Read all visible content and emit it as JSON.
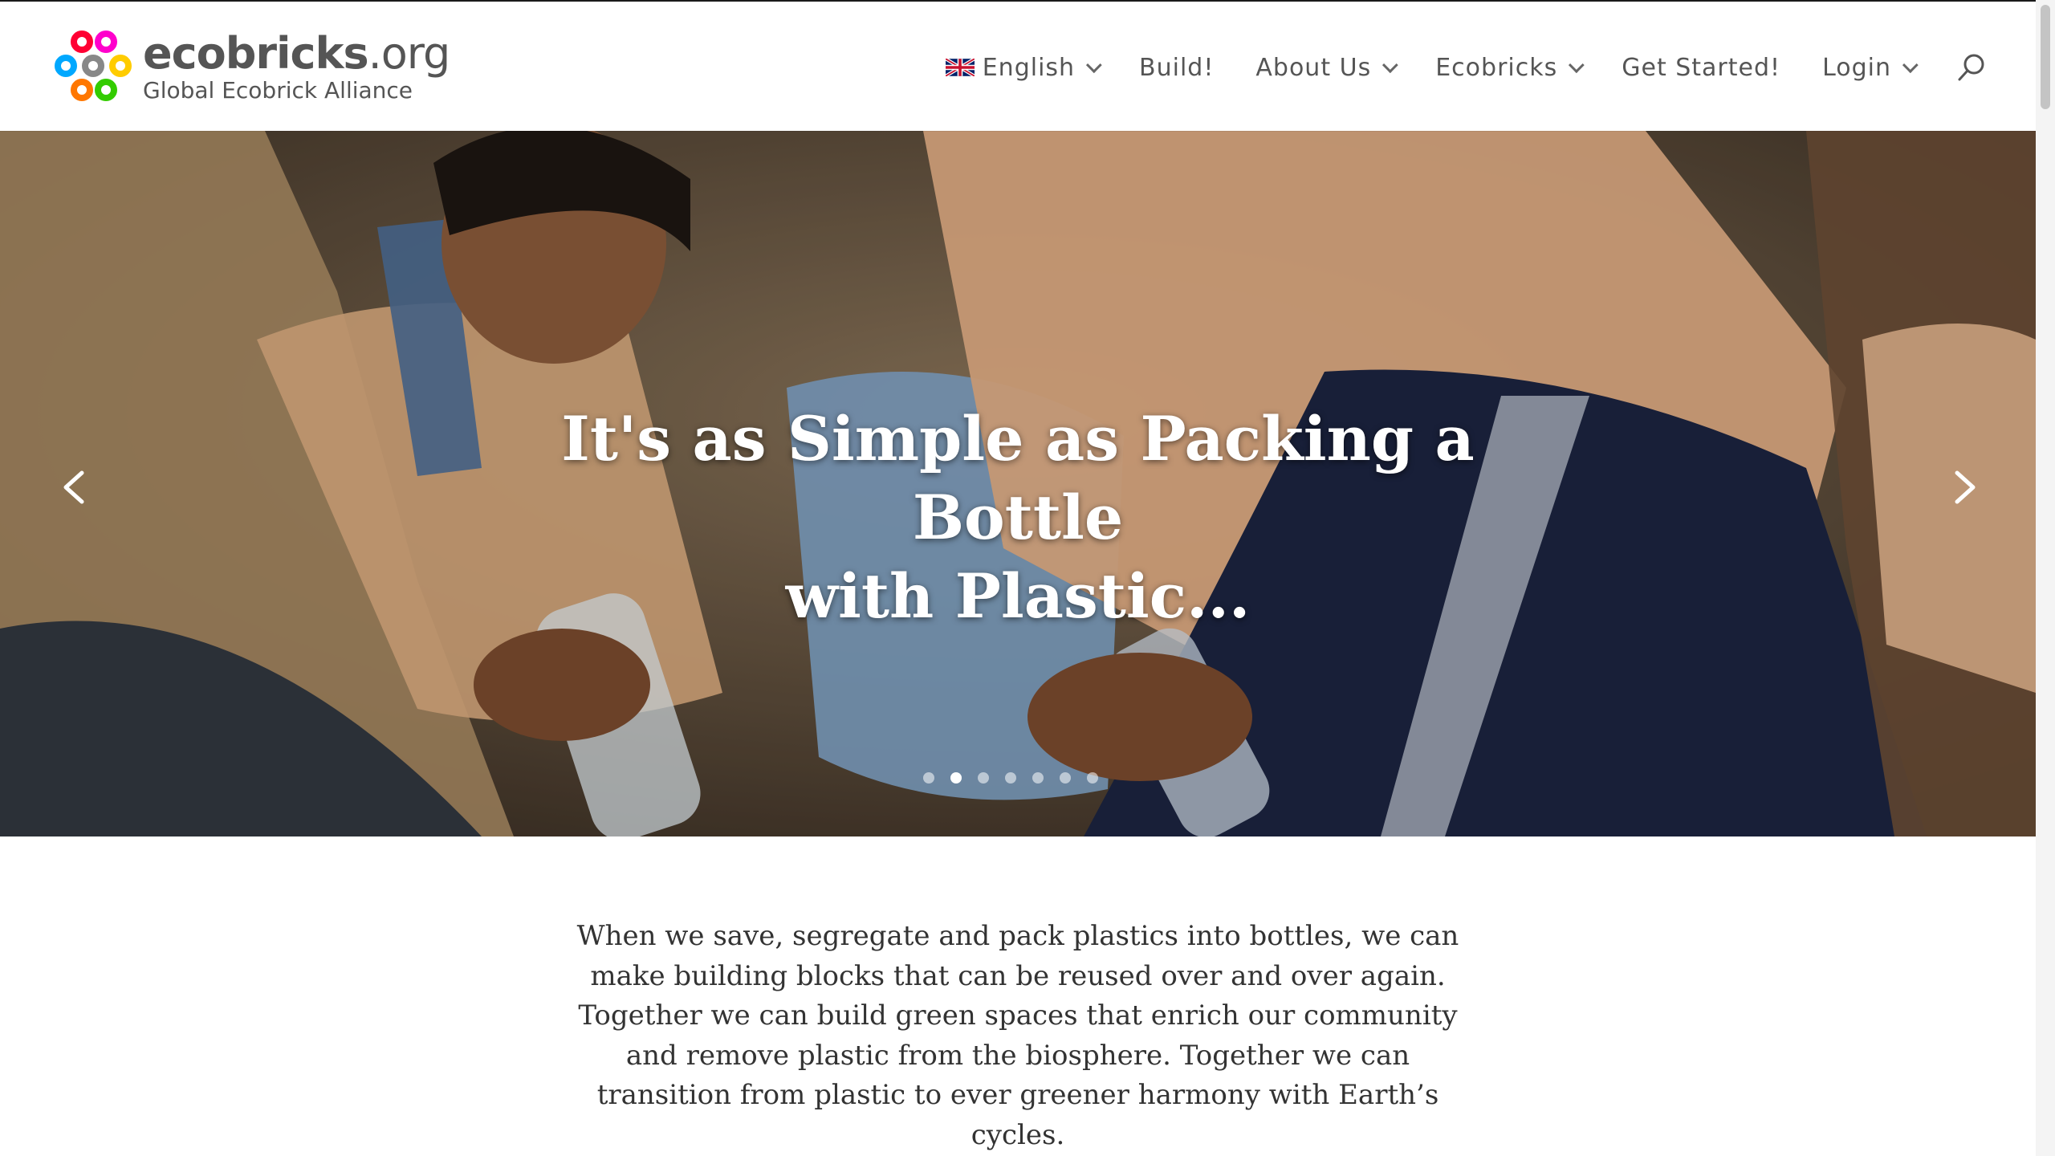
{
  "header": {
    "logo": {
      "title_main": "ecobricks",
      "title_tld": ".org",
      "subtitle": "Global Ecobrick Alliance",
      "ring_colors": [
        "#ff0033",
        "#ff00cc",
        "#00a8ff",
        "#888888",
        "#ffcc00",
        "#ff7700",
        "#33cc00"
      ]
    },
    "nav": {
      "language": "English",
      "build": "Build!",
      "about": "About Us",
      "ecobricks": "Ecobricks",
      "get_started": "Get Started!",
      "login": "Login"
    }
  },
  "hero": {
    "title_line1": "It's as Simple as Packing a Bottle",
    "title_line2": "with Plastic...",
    "slide_count": 7,
    "active_slide": 2
  },
  "intro": {
    "text": "When we save, segregate and pack plastics into bottles, we can make building blocks that can be reused over and over again. Together we can build green spaces that enrich our community and remove plastic from the biosphere.  Together we can transition from plastic to ever greener harmony with Earth’s cycles."
  },
  "colors": {
    "nav_text": "#555555",
    "body_text": "#333333",
    "hero_title": "#ffffff"
  }
}
